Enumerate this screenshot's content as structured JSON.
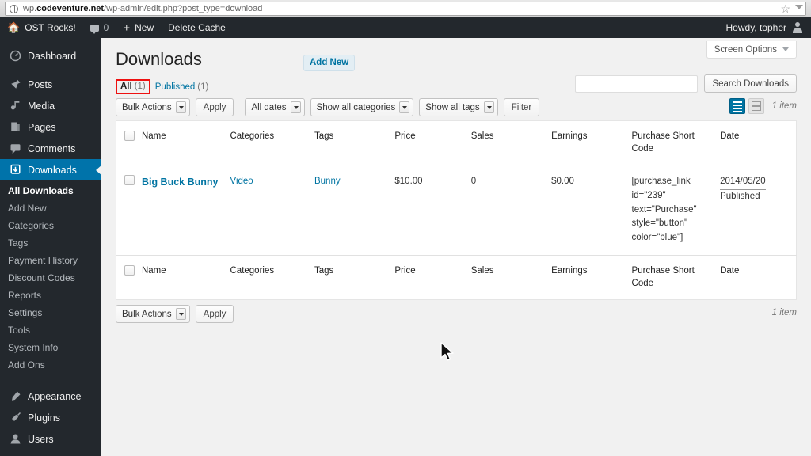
{
  "browser": {
    "url_prefix": "wp.",
    "url_domain": "codeventure.net",
    "url_path": "/wp-admin/edit.php?post_type=download",
    "globe_icon": "globe-icon",
    "star_icon": "bookmark-star-icon",
    "menu_icon": "chevron-down-icon"
  },
  "adminbar": {
    "site_name": "OST Rocks!",
    "home_icon": "home-icon",
    "comment_icon": "comment-bubble-icon",
    "comment_count": "0",
    "new_icon": "plus-icon",
    "new_label": "New",
    "delete_cache_label": "Delete Cache",
    "howdy": "Howdy, topher",
    "avatar_icon": "avatar-icon"
  },
  "sidebar": {
    "items": [
      {
        "label": "Dashboard",
        "icon": "dashboard-icon",
        "current": false
      },
      {
        "label": "Posts",
        "icon": "pin-icon",
        "current": false
      },
      {
        "label": "Media",
        "icon": "media-icon",
        "current": false
      },
      {
        "label": "Pages",
        "icon": "pages-icon",
        "current": false
      },
      {
        "label": "Comments",
        "icon": "comment-icon",
        "current": false
      },
      {
        "label": "Downloads",
        "icon": "download-icon",
        "current": true
      }
    ],
    "submenu": [
      {
        "label": "All Downloads",
        "current": true
      },
      {
        "label": "Add New",
        "current": false
      },
      {
        "label": "Categories",
        "current": false
      },
      {
        "label": "Tags",
        "current": false
      },
      {
        "label": "Payment History",
        "current": false
      },
      {
        "label": "Discount Codes",
        "current": false
      },
      {
        "label": "Reports",
        "current": false
      },
      {
        "label": "Settings",
        "current": false
      },
      {
        "label": "Tools",
        "current": false
      },
      {
        "label": "System Info",
        "current": false
      },
      {
        "label": "Add Ons",
        "current": false
      }
    ],
    "bottom_items": [
      {
        "label": "Appearance",
        "icon": "brush-icon"
      },
      {
        "label": "Plugins",
        "icon": "plug-icon"
      },
      {
        "label": "Users",
        "icon": "users-icon"
      }
    ],
    "accent_color": "#0073aa",
    "background_color": "#23282d"
  },
  "page": {
    "title": "Downloads",
    "add_new_label": "Add New",
    "screen_options_label": "Screen Options",
    "screen_options_icon": "chevron-down-icon"
  },
  "views": {
    "all_label": "All",
    "all_count": "(1)",
    "published_label": "Published",
    "published_count": "(1)",
    "highlight_color": "#ee1111"
  },
  "search": {
    "value": "",
    "placeholder": "",
    "button_label": "Search Downloads"
  },
  "tablenav_top": {
    "bulk_actions_label": "Bulk Actions",
    "apply_label": "Apply",
    "all_dates_label": "All dates",
    "categories_label": "Show all categories",
    "tags_label": "Show all tags",
    "filter_label": "Filter",
    "list_view_icon": "list-view-icon",
    "excerpt_view_icon": "excerpt-view-icon",
    "item_count": "1 item"
  },
  "tablenav_bottom": {
    "bulk_actions_label": "Bulk Actions",
    "apply_label": "Apply",
    "item_count": "1 item"
  },
  "table": {
    "columns": [
      "Name",
      "Categories",
      "Tags",
      "Price",
      "Sales",
      "Earnings",
      "Purchase Short Code",
      "Date"
    ],
    "rows": [
      {
        "name": "Big Buck Bunny",
        "categories": "Video",
        "tags": "Bunny",
        "price": "$10.00",
        "sales": "0",
        "earnings": "$0.00",
        "shortcode": "[purchase_link id=\"239\" text=\"Purchase\" style=\"button\" color=\"blue\"]",
        "date_value": "2014/05/20",
        "date_status": "Published"
      }
    ]
  }
}
